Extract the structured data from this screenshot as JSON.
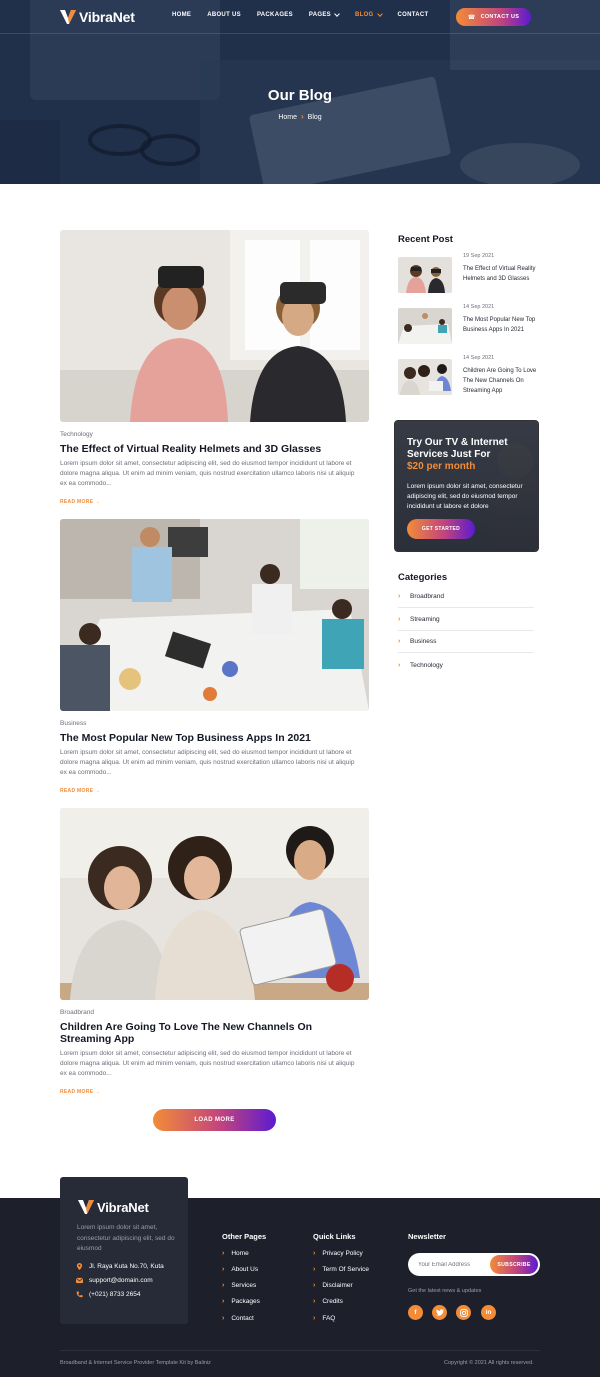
{
  "brand": {
    "name": "VibraNet",
    "accent": "#f28c38",
    "gradient_end": "#5b1bd1",
    "footer_bg": "#1d1f2b"
  },
  "nav": {
    "items": [
      {
        "label": "HOME"
      },
      {
        "label": "ABOUT US"
      },
      {
        "label": "PACKAGES"
      },
      {
        "label": "PAGES"
      },
      {
        "label": "BLOG"
      },
      {
        "label": "CONTACT"
      }
    ],
    "contact_button": "CONTACT US"
  },
  "hero": {
    "title": "Our Blog",
    "breadcrumb": [
      "Home",
      "Blog"
    ]
  },
  "posts": [
    {
      "category": "Technology",
      "title": "The Effect of Virtual Reality Helmets and 3D Glasses",
      "excerpt": "Lorem ipsum dolor sit amet, consectetur adipiscing elit, sed do eiusmod tempor incididunt ut labore et dolore magna aliqua. Ut enim ad minim veniam, quis nostrud exercitation ullamco laboris nisi ut aliquip ex ea commodo...",
      "read_more": "READ MORE"
    },
    {
      "category": "Business",
      "title": "The Most Popular New Top Business Apps In 2021",
      "excerpt": "Lorem ipsum dolor sit amet, consectetur adipiscing elit, sed do eiusmod tempor incididunt ut labore et dolore magna aliqua. Ut enim ad minim veniam, quis nostrud exercitation ullamco laboris nisi ut aliquip ex ea commodo...",
      "read_more": "READ MORE"
    },
    {
      "category": "Broadbrand",
      "title": "Children Are Going To Love The New Channels On Streaming App",
      "excerpt": "Lorem ipsum dolor sit amet, consectetur adipiscing elit, sed do eiusmod tempor incididunt ut labore et dolore magna aliqua. Ut enim ad minim veniam, quis nostrud exercitation ullamco laboris nisi ut aliquip ex ea commodo...",
      "read_more": "READ MORE"
    }
  ],
  "load_more": "LOAD MORE",
  "sidebar": {
    "recent_heading": "Recent Post",
    "recent": [
      {
        "date": "19 Sep 2021",
        "title": "The Effect of Virtual Reality Helmets and 3D Glasses"
      },
      {
        "date": "14 Sep 2021",
        "title": "The Most Popular New Top Business Apps In 2021"
      },
      {
        "date": "14 Sep 2021",
        "title": "Children Are Going To Love The New Channels On Streaming App"
      }
    ],
    "promo": {
      "title": "Try Our TV & Internet Services Just For",
      "price": "$20 per month",
      "text": "Lorem ipsum dolor sit amet, consectetur adipiscing elit, sed do eiusmod tempor incididunt ut labore et dolore",
      "button": "GET STARTED"
    },
    "categories_heading": "Categories",
    "categories": [
      "Broadbrand",
      "Streaming",
      "Business",
      "Technology"
    ]
  },
  "footer": {
    "about": "Lorem ipsum dolor sit amet, consectetur adipiscing elit, sed do eiusmod",
    "address": "Jl. Raya Kuta No.70, Kuta",
    "email": "support@domain.com",
    "phone": "(+021) 8733 2654",
    "other_pages_heading": "Other Pages",
    "other_pages": [
      "Home",
      "About Us",
      "Services",
      "Packages",
      "Contact"
    ],
    "quick_links_heading": "Quick Links",
    "quick_links": [
      "Privacy Policy",
      "Term Of Service",
      "Disclaimer",
      "Credits",
      "FAQ"
    ],
    "newsletter_heading": "Newsletter",
    "newsletter_placeholder": "Your Email Address",
    "subscribe": "SUBSCRIBE",
    "newsletter_note": "Get the latest news & updates",
    "social": [
      "facebook-icon",
      "twitter-icon",
      "instagram-icon",
      "linkedin-icon"
    ],
    "credit": "Broadband & Internet Service Provider Template Kit by Baliniz",
    "copyright": "Copyright © 2021 All rights reserved."
  }
}
